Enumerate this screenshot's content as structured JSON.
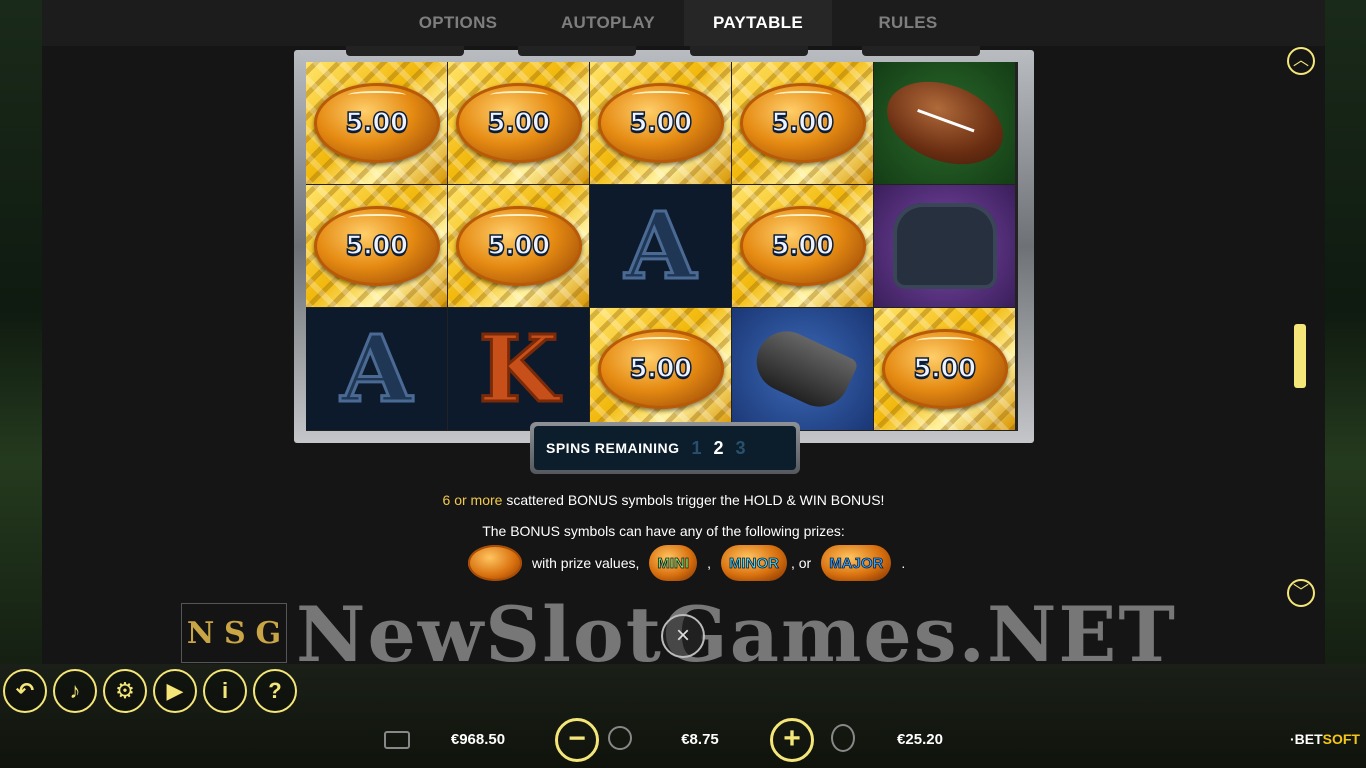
{
  "tabs": [
    {
      "label": "OPTIONS",
      "active": false
    },
    {
      "label": "AUTOPLAY",
      "active": false
    },
    {
      "label": "PAYTABLE",
      "active": true
    },
    {
      "label": "RULES",
      "active": false
    }
  ],
  "reels": {
    "prize_value": "5.00",
    "letters": {
      "a": "A",
      "k": "K"
    }
  },
  "spins_remaining": {
    "label": "SPINS REMAINING",
    "numbers": [
      "1",
      "2",
      "3"
    ],
    "current": "2"
  },
  "paytable": {
    "line1_highlight": "6 or more",
    "line1_rest": " scattered BONUS symbols trigger the HOLD & WIN BONUS!",
    "line2": "The BONUS symbols can have any of the following prizes:",
    "with_prize_values": "with prize values,",
    "jackpots": [
      "MINI",
      "MINOR",
      "MAJOR"
    ],
    "sep_comma": ",",
    "sep_or": ", or",
    "end_period": "."
  },
  "watermark": {
    "logo_letters": [
      "N",
      "S",
      "G"
    ],
    "text": "NewSlotGames.NET"
  },
  "close_glyph": "×",
  "scroll_position_fraction": 0.55,
  "bottom_bar": {
    "balance": "€968.50",
    "bet": "€8.75",
    "win": "€25.20",
    "brand_prefix": "·BET",
    "brand_suffix": "SOFT",
    "minus_glyph": "−",
    "plus_glyph": "+"
  },
  "colors": {
    "accent": "#f4e678",
    "highlight_text": "#f2c94c",
    "panel_bg": "#151515"
  },
  "icons": {
    "scroll_up": "chevron-up-icon",
    "scroll_down": "chevron-down-icon",
    "close": "close-icon",
    "back": "back-arrow-icon",
    "sound": "speaker-icon",
    "settings": "gear-icon",
    "autoplay": "autoplay-icon",
    "info": "info-icon",
    "help": "question-icon",
    "wallet": "wallet-icon",
    "coins": "coins-icon",
    "win": "medal-icon"
  }
}
